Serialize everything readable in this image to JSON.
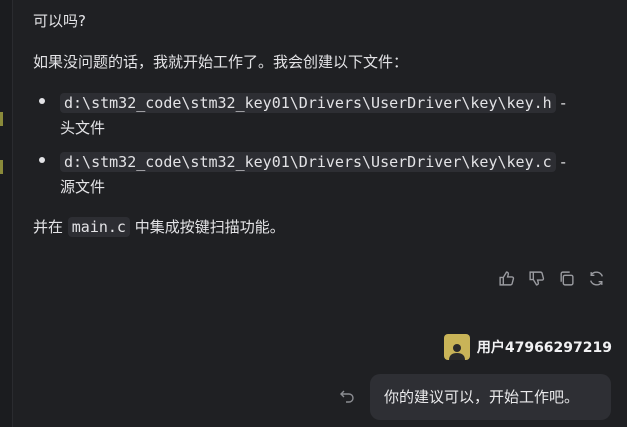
{
  "assistant": {
    "line1": "可以吗?",
    "line2": "如果没问题的话，我就开始工作了。我会创建以下文件：",
    "files": [
      {
        "path": "d:\\stm32_code\\stm32_key01\\Drivers\\UserDriver\\key\\key.h",
        "sep": " -",
        "desc": "头文件"
      },
      {
        "path": "d:\\stm32_code\\stm32_key01\\Drivers\\UserDriver\\key\\key.c",
        "sep": " -",
        "desc": "源文件"
      }
    ],
    "line3_pre": "并在 ",
    "line3_code": "main.c",
    "line3_post": " 中集成按键扫描功能。",
    "actions": [
      "thumbs-up-icon",
      "thumbs-down-icon",
      "copy-icon",
      "regenerate-icon"
    ]
  },
  "user": {
    "name": "用户47966297219",
    "message": "你的建议可以，开始工作吧。"
  },
  "colors": {
    "background": "#1f2023",
    "bubble": "#2e2f34",
    "code_bg": "#2d2e33",
    "avatar": "#c9b458"
  }
}
